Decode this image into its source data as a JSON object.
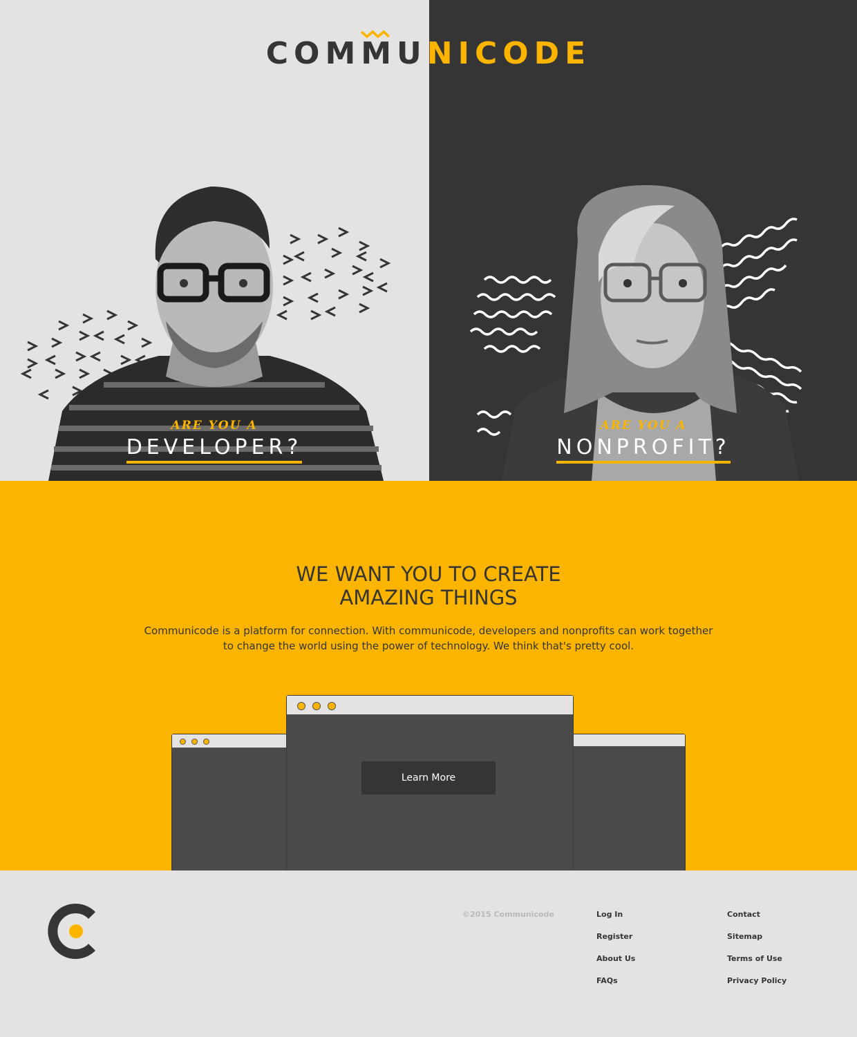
{
  "brand": {
    "part1": "COMMU",
    "part2": "NICODE",
    "accent": "#fbb500",
    "dark": "#353535"
  },
  "hero": {
    "developer": {
      "eyebrow": "ARE YOU A",
      "title": "DEVELOPER?"
    },
    "nonprofit": {
      "eyebrow": "ARE YOU A",
      "title": "NONPROFIT?"
    }
  },
  "about": {
    "headline_line1": "WE WANT YOU TO CREATE",
    "headline_line2": "AMAZING THINGS",
    "body_line1": "Communicode is a platform for connection. With communicode, developers and nonprofits can work together",
    "body_line2": "to change the world using the power of technology. We think that's pretty cool.",
    "cta_label": "Learn More"
  },
  "footer": {
    "copyright": "©2015 Communicode",
    "col1": [
      "Log In",
      "Register",
      "About Us",
      "FAQs"
    ],
    "col2": [
      "Contact",
      "Sitemap",
      "Terms of Use",
      "Privacy Policy"
    ]
  }
}
